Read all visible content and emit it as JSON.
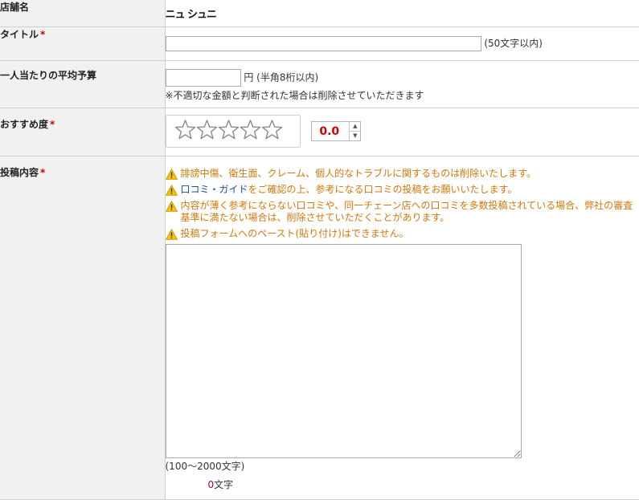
{
  "shop": {
    "label": "店舗名",
    "value": "ニュ シュニ"
  },
  "title": {
    "label": "タイトル",
    "required_mark": "*",
    "value": "",
    "hint": "(50文字以内)"
  },
  "budget": {
    "label": "一人当たりの平均予算",
    "value": "",
    "unit_hint": "円 (半角8桁以内)",
    "note": "※不適切な金額と判断された場合は削除させていただきます"
  },
  "rating": {
    "label": "おすすめ度",
    "required_mark": "*",
    "stars": 5,
    "stars_filled": 0,
    "value": "0.0",
    "spin_up": "▲",
    "spin_down": "▼"
  },
  "post": {
    "label": "投稿内容",
    "required_mark": "*",
    "warnings": [
      {
        "text": "誹謗中傷、衛生面、クレーム、個人的なトラブルに関するものは削除いたします。"
      },
      {
        "link": "口コミ・ガイド",
        "text": "をご確認の上、参考になる口コミの投稿をお願いいたします。"
      },
      {
        "text": "内容が薄く参考にならない口コミや、同一チェーン店への口コミを多数投稿されている場合、弊社の審査基準に満たない場合は、削除させていただくことがあります。"
      },
      {
        "text": "投稿フォームへのペースト(貼り付け)はできません。"
      }
    ],
    "textarea_value": "",
    "range_hint": "(100～2000文字)",
    "count_value": "0",
    "count_unit": "文字"
  },
  "colors": {
    "warning": "#d2780a",
    "link": "#1a4ea6",
    "required": "#cc0000",
    "score": "#d00000"
  },
  "icons": {
    "warning": "warning-triangle-icon",
    "star": "star-outline-icon"
  }
}
